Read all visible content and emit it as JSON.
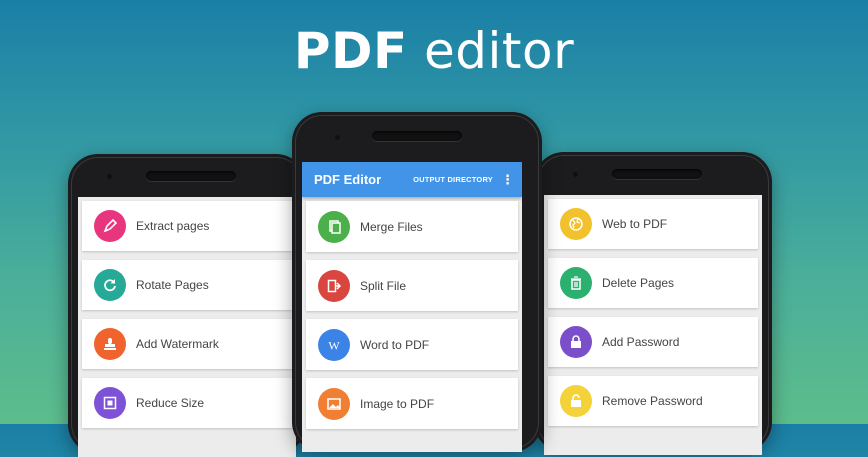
{
  "headline": {
    "bold": "PDF",
    "light": "editor"
  },
  "app": {
    "title": "PDF Editor",
    "action": "OUTPUT DIRECTORY",
    "overflow_icon": "⋮"
  },
  "left_items": [
    {
      "label": "Extract pages",
      "icon": "pen-icon",
      "color": "#e8367e"
    },
    {
      "label": "Rotate Pages",
      "icon": "rotate-icon",
      "color": "#26a996"
    },
    {
      "label": "Add Watermark",
      "icon": "stamp-icon",
      "color": "#f0632e"
    },
    {
      "label": "Reduce Size",
      "icon": "compress-icon",
      "color": "#7e52d6"
    }
  ],
  "mid_items": [
    {
      "label": "Merge Files",
      "icon": "merge-icon",
      "color": "#4bb04a"
    },
    {
      "label": "Split File",
      "icon": "split-icon",
      "color": "#d9463f"
    },
    {
      "label": "Word to PDF",
      "icon": "word-icon",
      "color": "#3b83e6"
    },
    {
      "label": "Image to PDF",
      "icon": "image-icon",
      "color": "#f07f33"
    }
  ],
  "right_items": [
    {
      "label": "Web to PDF",
      "icon": "globe-icon",
      "color": "#f2c12e"
    },
    {
      "label": "Delete Pages",
      "icon": "trash-icon",
      "color": "#2bb06f"
    },
    {
      "label": "Add Password",
      "icon": "lock-icon",
      "color": "#7a4fc9"
    },
    {
      "label": "Remove Password",
      "icon": "unlock-icon",
      "color": "#f3d23a"
    }
  ]
}
